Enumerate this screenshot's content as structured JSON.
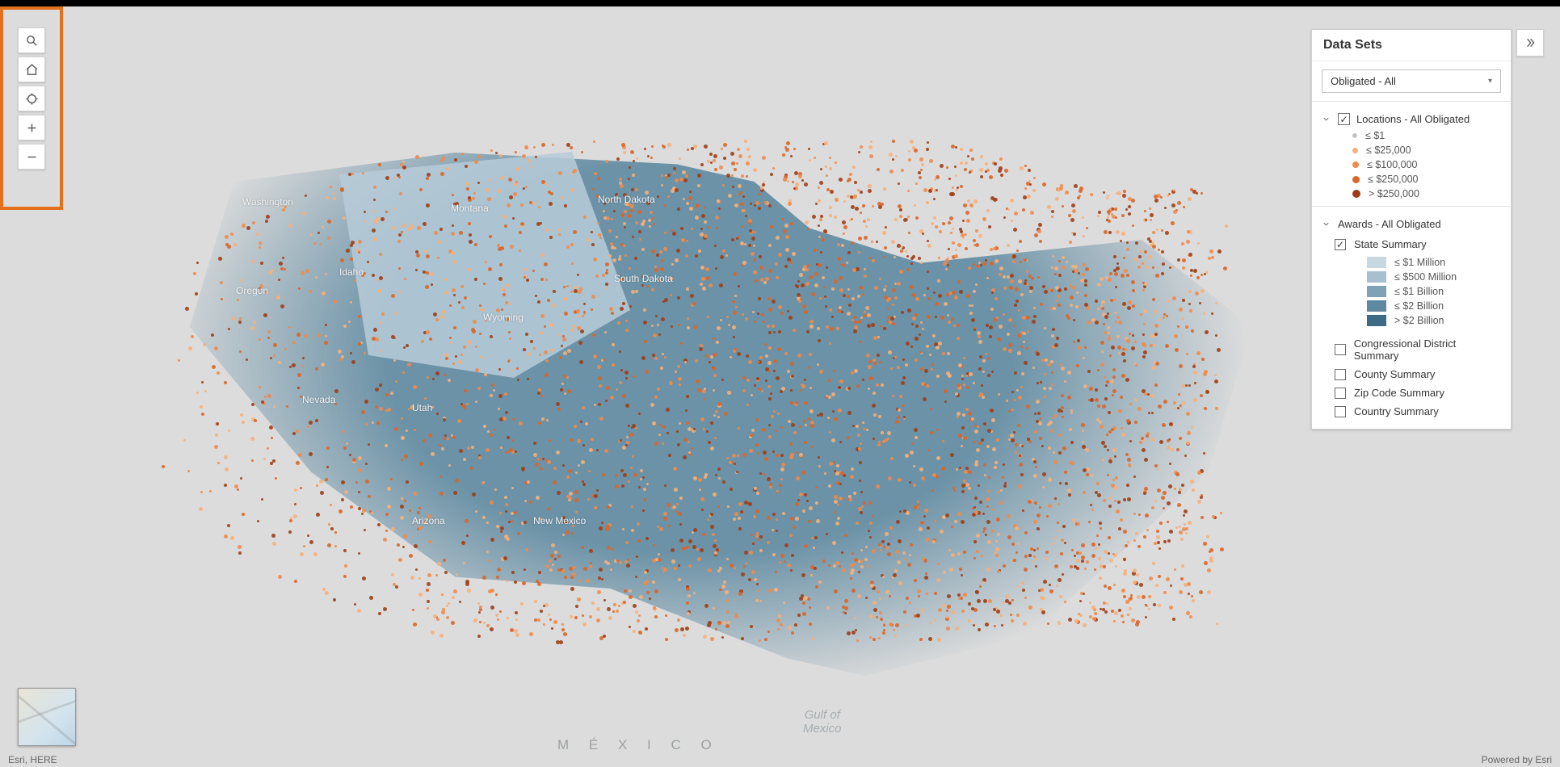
{
  "panel": {
    "title": "Data Sets",
    "dropdown_selected": "Obligated - All",
    "layers": {
      "locations": {
        "label": "Locations - All Obligated",
        "checked": true,
        "expanded": true,
        "legend": [
          {
            "label": "≤ $1",
            "color": "#c0c5c8",
            "size": 6
          },
          {
            "label": "≤ $25,000",
            "color": "#f6b07a",
            "size": 7
          },
          {
            "label": "≤ $100,000",
            "color": "#ee8b4c",
            "size": 8
          },
          {
            "label": "≤ $250,000",
            "color": "#d9662a",
            "size": 9
          },
          {
            "label": "> $250,000",
            "color": "#9e3e17",
            "size": 10
          }
        ]
      },
      "awards": {
        "label": "Awards - All Obligated",
        "expanded": true,
        "sublayers": {
          "state": {
            "label": "State Summary",
            "checked": true,
            "legend": [
              {
                "label": "≤ $1 Million",
                "color": "#c8d7e0"
              },
              {
                "label": "≤ $500 Million",
                "color": "#a7c0cf"
              },
              {
                "label": "≤ $1 Billion",
                "color": "#7fa2b6"
              },
              {
                "label": "≤ $2 Billion",
                "color": "#5e889f"
              },
              {
                "label": "> $2 Billion",
                "color": "#3d6b85"
              }
            ]
          },
          "cd": {
            "label": "Congressional District Summary",
            "checked": false
          },
          "county": {
            "label": "County Summary",
            "checked": false
          },
          "zip": {
            "label": "Zip Code Summary",
            "checked": false
          },
          "country": {
            "label": "Country Summary",
            "checked": false
          }
        }
      }
    }
  },
  "map_labels": {
    "mexico": "M  É  X  I  C  O",
    "gulf": "Gulf of\nMexico",
    "states": {
      "washington": "Washington",
      "oregon": "Oregon",
      "idaho": "Idaho",
      "montana": "Montana",
      "wyoming": "Wyoming",
      "northdakota": "North Dakota",
      "southdakota": "South Dakota",
      "nevada": "Nevada",
      "utah": "Utah",
      "arizona": "Arizona",
      "newmexico": "New Mexico"
    }
  },
  "attribution": {
    "left": "Esri, HERE",
    "right": "Powered by Esri"
  },
  "icons": {
    "search": "search-icon",
    "home": "home-icon",
    "locate": "locate-icon",
    "zoom_in": "plus-icon",
    "zoom_out": "minus-icon",
    "collapse": "chevrons-right-icon"
  }
}
